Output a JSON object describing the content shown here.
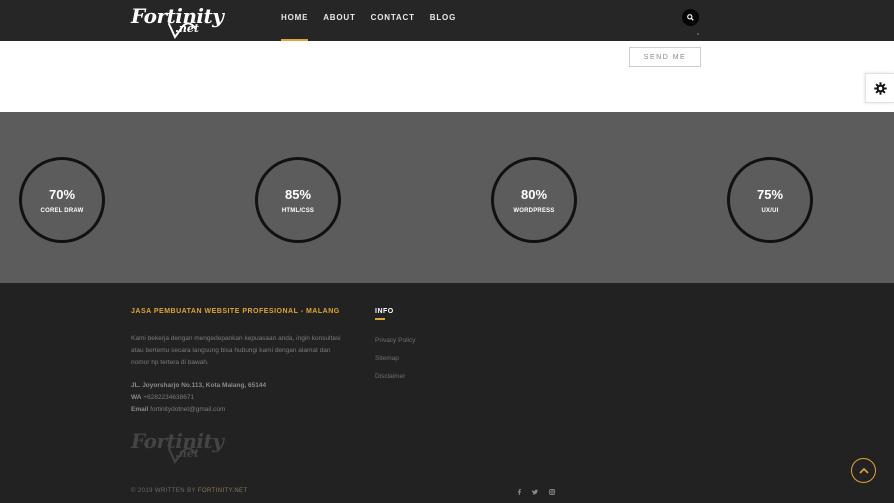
{
  "header": {
    "logo_text": "Fortinity",
    "logo_sub": ".net",
    "nav": [
      {
        "label": "HOME",
        "active": true
      },
      {
        "label": "ABOUT",
        "active": false
      },
      {
        "label": "CONTACT",
        "active": false
      },
      {
        "label": "BLOG",
        "active": false
      }
    ],
    "search_icon": "search-icon"
  },
  "form": {
    "send_label": "SEND ME",
    "settings_icon": "gear-icon"
  },
  "skills": [
    {
      "value": "70%",
      "label": "COREL DRAW"
    },
    {
      "value": "85%",
      "label": "HTML/CSS"
    },
    {
      "value": "80%",
      "label": "WORDPRESS"
    },
    {
      "value": "75%",
      "label": "UX/UI"
    }
  ],
  "footer": {
    "about_title": "JASA PEMBUATAN WEBSITE PROFESIONAL - MALANG",
    "about_text_1": "Kami bekerja dengan mengedepankan kepuasaan anda, ingin konsultasi",
    "about_text_2": "atau bertemu secara langsung bisa hubungi kami dengan alamat dan",
    "about_text_3": "nomor hp tertera di bawah.",
    "address": "JL. Joyorsharjo No.113, Kota Malang, 65144",
    "wa_label": "WA",
    "wa_value": "+6282234638671",
    "email_label": "Email",
    "email_value": "fortinitydotnet@gmail.com",
    "info_title": "INFO",
    "links": [
      "Privacy Policy",
      "Sitemap",
      "Disclaimer"
    ],
    "copyright_prefix": "© 2019 WRITTEN BY",
    "copyright_brand": "FORTINITY.NET",
    "social": [
      "f",
      "t",
      "ig"
    ]
  },
  "colors": {
    "accent": "#e0a534",
    "header_bg": "#262626",
    "skills_bg": "#5c5c5c",
    "footer_bg": "#222222"
  }
}
